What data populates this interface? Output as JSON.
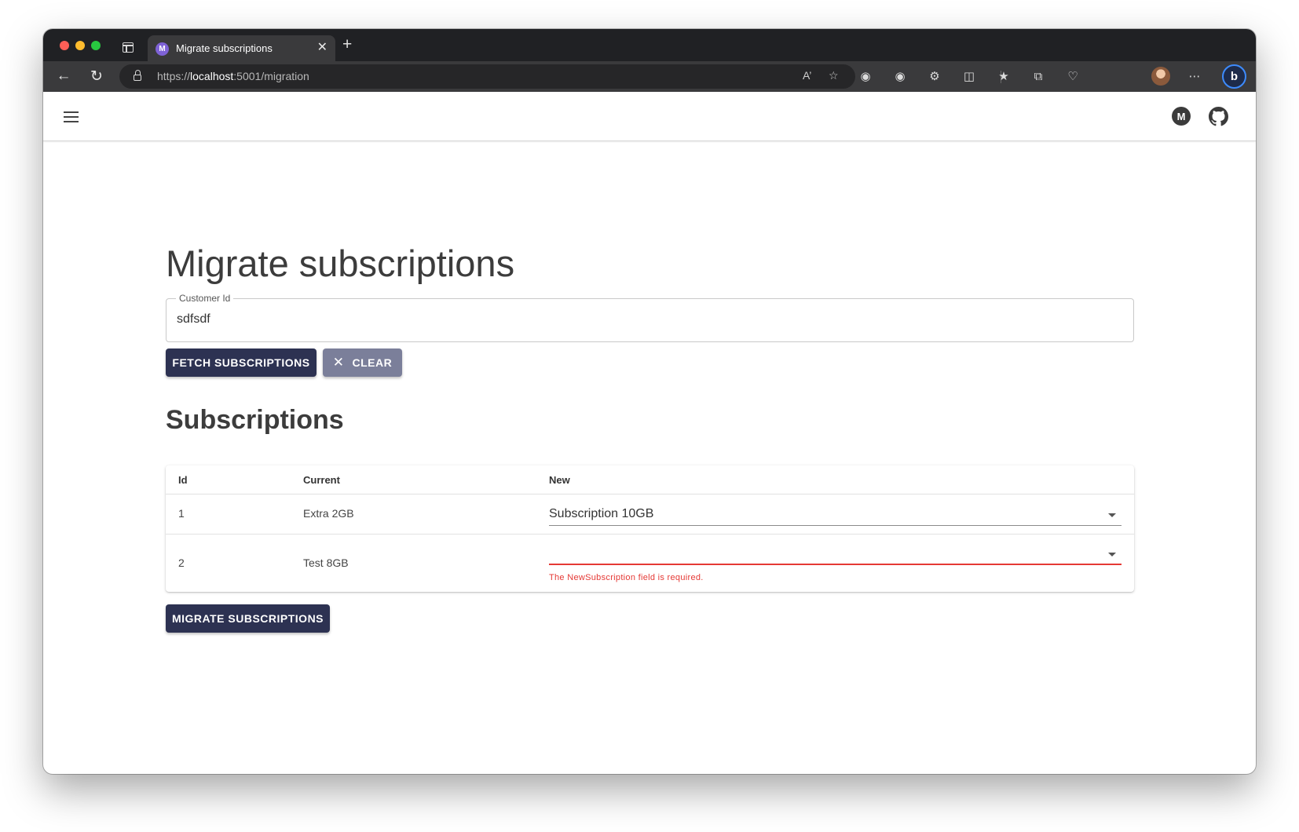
{
  "browser": {
    "tab_title": "Migrate subscriptions",
    "url_scheme": "https://",
    "url_host": "localhost",
    "url_rest": ":5001/migration",
    "favicon_letter": "M",
    "copilot_letter": "b"
  },
  "appbar": {
    "menu_icon": "hamburger-menu-icon",
    "brand_icon": "mudblazor-icon",
    "github_icon": "github-icon"
  },
  "page": {
    "title": "Migrate subscriptions",
    "customer_field": {
      "label": "Customer Id",
      "value": "sdfsdf"
    },
    "fetch_button": "FETCH SUBSCRIPTIONS",
    "clear_button": "CLEAR",
    "section_title": "Subscriptions",
    "table": {
      "headers": [
        "Id",
        "Current",
        "New"
      ],
      "rows": [
        {
          "id": "1",
          "current": "Extra 2GB",
          "new": "Subscription 10GB",
          "error": ""
        },
        {
          "id": "2",
          "current": "Test 8GB",
          "new": "",
          "error": "The NewSubscription field is required."
        }
      ]
    },
    "migrate_button": "MIGRATE SUBSCRIPTIONS"
  },
  "colors": {
    "primary": "#2d3252",
    "secondary": "#7b7f9a",
    "error": "#e53935"
  }
}
